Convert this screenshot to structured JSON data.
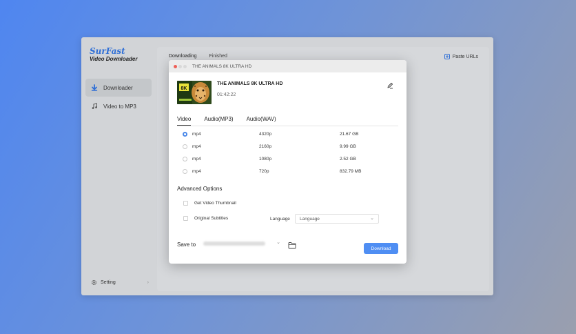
{
  "app": {
    "brand_name": "SurFast",
    "brand_sub": "Video Downloader",
    "sidebar": {
      "items": [
        {
          "label": "Downloader",
          "icon": "download-arrow-icon",
          "active": true
        },
        {
          "label": "Video to MP3",
          "icon": "music-note-icon",
          "active": false
        }
      ],
      "setting_label": "Setting",
      "setting_arrow": "›"
    },
    "tabs": [
      {
        "label": "Downloading",
        "active": true
      },
      {
        "label": "Finished",
        "active": false
      }
    ],
    "paste_label": "Paste URLs"
  },
  "dialog": {
    "window_title": "THE ANIMALS 8K ULTRA HD",
    "video_title": "THE ANIMALS 8K ULTRA HD",
    "duration": "01:42:22",
    "thumbnail_text": "8K",
    "format_tabs": [
      {
        "label": "Video",
        "active": true
      },
      {
        "label": "Audio(MP3)",
        "active": false
      },
      {
        "label": "Audio(WAV)",
        "active": false
      }
    ],
    "options": [
      {
        "format": "mp4",
        "resolution": "4320p",
        "size": "21.67 GB",
        "selected": true
      },
      {
        "format": "mp4",
        "resolution": "2160p",
        "size": "9.99 GB",
        "selected": false
      },
      {
        "format": "mp4",
        "resolution": "1080p",
        "size": "2.52 GB",
        "selected": false
      },
      {
        "format": "mp4",
        "resolution": "720p",
        "size": "832.79 MB",
        "selected": false
      }
    ],
    "advanced_title": "Advanced Options",
    "get_thumbnail_label": "Get Video Thumbnail",
    "get_thumbnail_checked": false,
    "subtitles_label": "Original Subtitles",
    "subtitles_checked": false,
    "language_label": "Language",
    "language_value": "Language",
    "save_to_label": "Save to",
    "download_label": "Download"
  },
  "colors": {
    "accent": "#4f8ef3",
    "brand": "#2f6fd6",
    "close_dot": "#ee5f57"
  }
}
